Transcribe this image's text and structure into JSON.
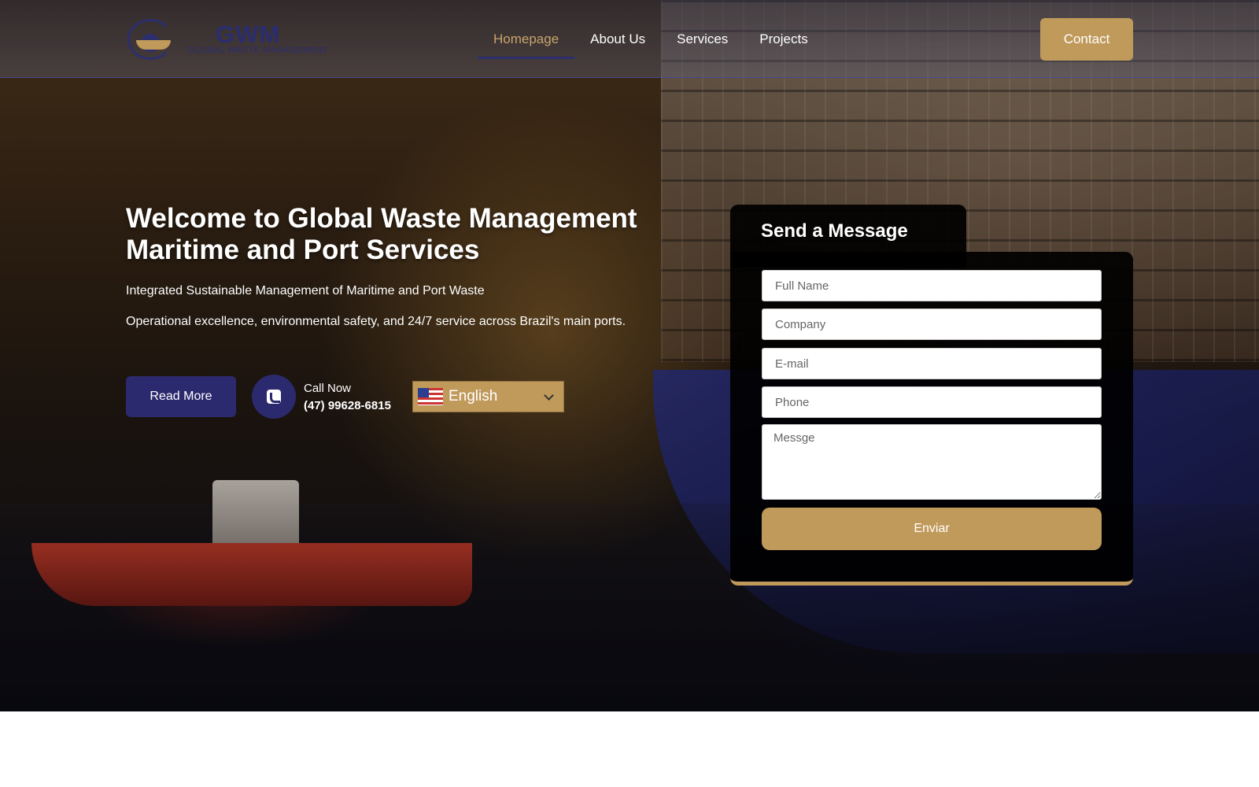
{
  "header": {
    "logo_title": "GWM",
    "logo_subtitle": "GLOBAL WASTE MANAGEMENT",
    "nav": [
      {
        "label": "Homepage"
      },
      {
        "label": "About Us"
      },
      {
        "label": "Services"
      },
      {
        "label": "Projects"
      }
    ],
    "contact_label": "Contact"
  },
  "hero": {
    "title_line1": "Welcome to Global Waste Management",
    "title_line2": "Maritime and Port Services",
    "subtitle1": "Integrated Sustainable Management of Maritime and Port Waste",
    "subtitle2": "Operational excellence, environmental safety, and 24/7 service across Brazil's main ports.",
    "read_more_label": "Read More",
    "call_label": "Call Now",
    "call_number": "(47) 99628-6815",
    "language": {
      "selected": "English",
      "flag_icon": "us-flag-icon"
    }
  },
  "form": {
    "title": "Send a Message",
    "full_name_placeholder": "Full Name",
    "company_placeholder": "Company",
    "email_placeholder": "E-mail",
    "phone_placeholder": "Phone",
    "message_placeholder": "Messge",
    "submit_label": "Enviar"
  },
  "colors": {
    "brand_navy": "#2c2a6e",
    "brand_gold": "#c09a5b",
    "nav_active": "#c8a468"
  }
}
